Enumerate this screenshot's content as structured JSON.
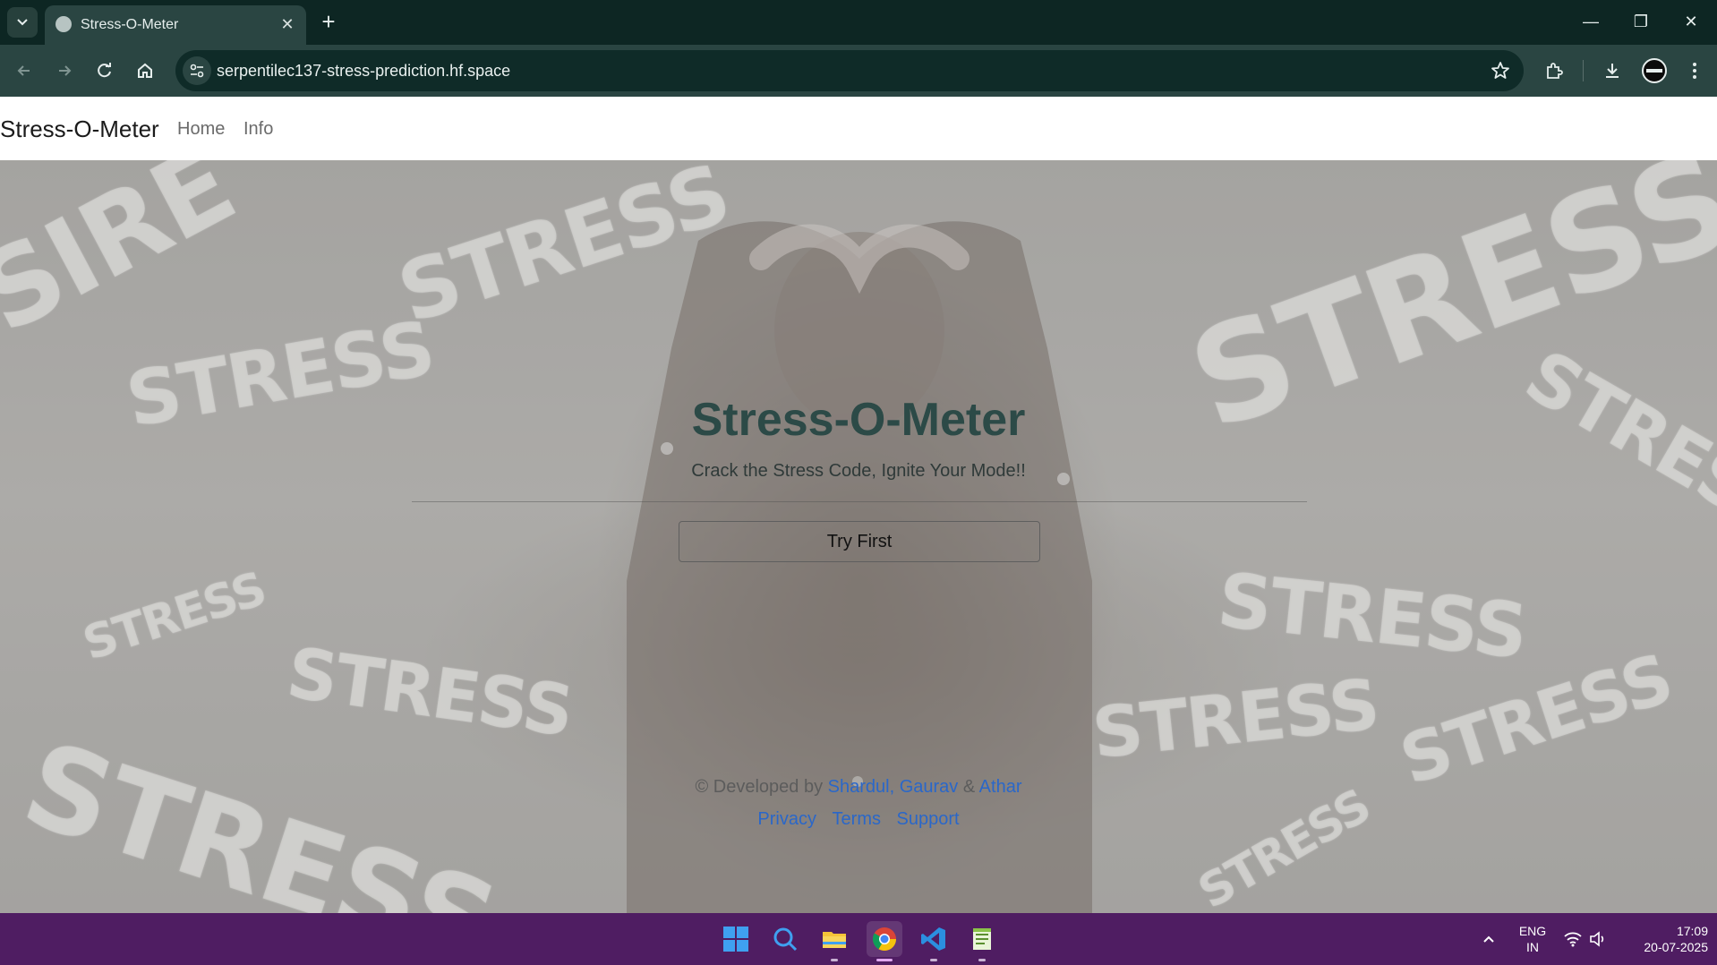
{
  "browser": {
    "tab_title": "Stress-O-Meter",
    "url": "serpentilec137-stress-prediction.hf.space",
    "new_tab_label": "+",
    "close_tab_label": "✕",
    "window_controls": {
      "minimize": "—",
      "restore": "❐",
      "close": "✕"
    }
  },
  "nav": {
    "brand": "Stress-O-Meter",
    "links": [
      "Home",
      "Info"
    ]
  },
  "background_words": {
    "stress": "STRESS",
    "partial_top_left": "SIRE",
    "partial_bottom_left": "STRESS"
  },
  "hero": {
    "title": "Stress-O-Meter",
    "subtitle": "Crack the Stress Code, Ignite Your Mode!!",
    "cta": "Try First"
  },
  "footer": {
    "prefix": "© Developed by",
    "dev1": "Shardul, Gaurav",
    "ampersand": "&",
    "dev2": "Athar",
    "links": [
      "Privacy",
      "Terms",
      "Support"
    ]
  },
  "taskbar": {
    "apps": [
      "windows-start-icon",
      "search-icon",
      "file-explorer-icon",
      "chrome-icon",
      "vscode-icon",
      "notepad-icon"
    ],
    "language_line1": "ENG",
    "language_line2": "IN",
    "time": "17:09",
    "date": "20-07-2025"
  },
  "colors": {
    "chrome_dark": "#0d2623",
    "chrome_toolbar": "#2a4542",
    "hero_title": "#2c4a47",
    "link_blue": "#2a67c9",
    "taskbar": "#4f1d62"
  }
}
